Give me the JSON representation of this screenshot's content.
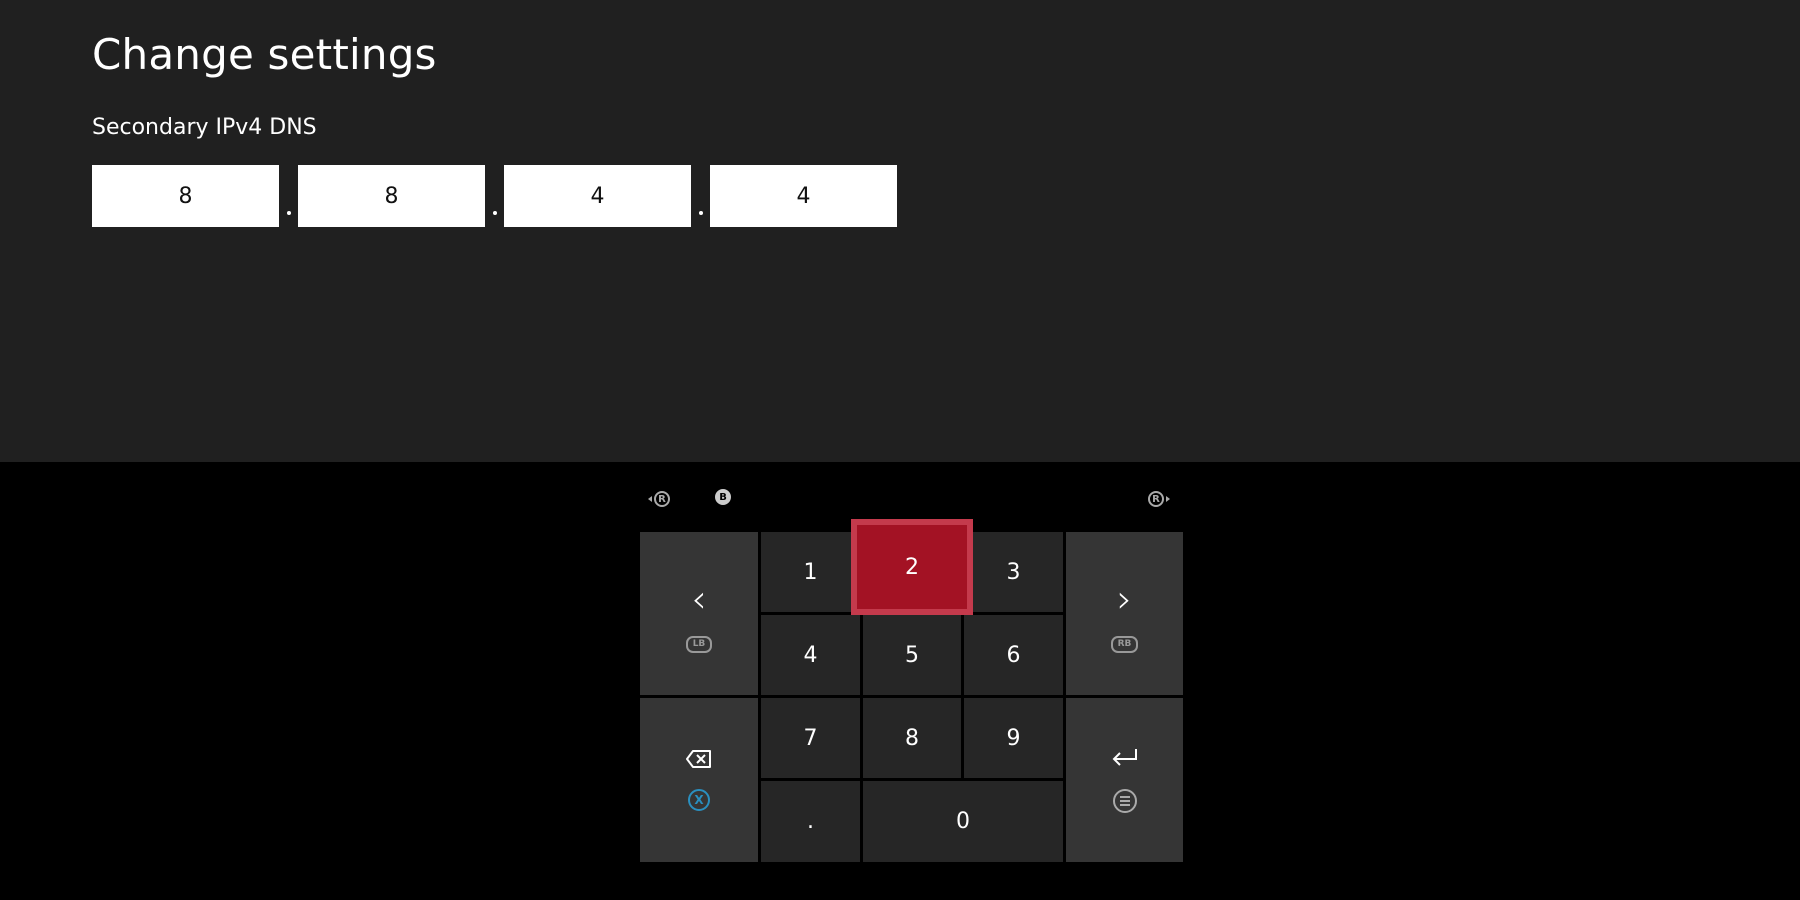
{
  "header": {
    "title": "Change settings",
    "field_label": "Secondary IPv4 DNS"
  },
  "ip_fields": {
    "octets": [
      "8",
      "8",
      "4",
      "4"
    ]
  },
  "keypad": {
    "hints": {
      "left_stick": "R",
      "b_button": "B",
      "right_stick": "R"
    },
    "keys": {
      "k1": "1",
      "k2": "2",
      "k3": "3",
      "k4": "4",
      "k5": "5",
      "k6": "6",
      "k7": "7",
      "k8": "8",
      "k9": "9",
      "dot": ".",
      "k0": "0"
    },
    "focused_key": "2",
    "side": {
      "left_arrow_icon": "chevron-left-icon",
      "left_arrow_hint": "LB",
      "right_arrow_icon": "chevron-right-icon",
      "right_arrow_hint": "RB",
      "backspace_icon": "backspace-icon",
      "backspace_hint": "X",
      "enter_icon": "enter-icon",
      "enter_hint": "menu-button-icon"
    },
    "colors": {
      "focus": "#a31224",
      "x_button": "#2a8fbf"
    }
  }
}
